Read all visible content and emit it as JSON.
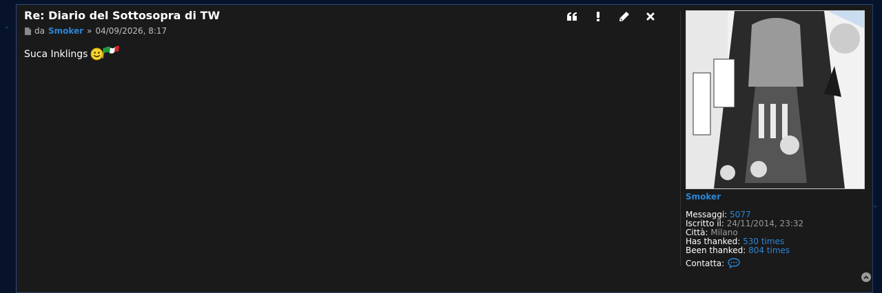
{
  "post": {
    "title": "Re: Diario del Sottosopra di TW",
    "meta_prefix": "da",
    "author": "Smoker",
    "meta_separator": "»",
    "datetime": "04/09/2026, 8:17",
    "body_text": "Suca Inklings"
  },
  "actions": [
    {
      "name": "quote-button",
      "icon": "quote-icon",
      "glyph": "❝"
    },
    {
      "name": "report-button",
      "icon": "exclamation-icon",
      "glyph": "!"
    },
    {
      "name": "edit-button",
      "icon": "pencil-icon",
      "glyph": "✎"
    },
    {
      "name": "delete-button",
      "icon": "close-icon",
      "glyph": "✖"
    }
  ],
  "profile": {
    "username": "Smoker",
    "messages_label": "Messaggi:",
    "messages_value": "5077",
    "registered_label": "Iscritto il:",
    "registered_value": "24/11/2014, 23:32",
    "city_label": "Città:",
    "city_value": "Milano",
    "has_thanked_label": "Has thanked:",
    "has_thanked_value": "530 times",
    "been_thanked_label": "Been thanked:",
    "been_thanked_value": "804 times",
    "contact_label": "Contatta:"
  },
  "colors": {
    "accent": "#2b86d6",
    "post_bg": "#1a1a1a",
    "page_bg": "#07132a"
  }
}
